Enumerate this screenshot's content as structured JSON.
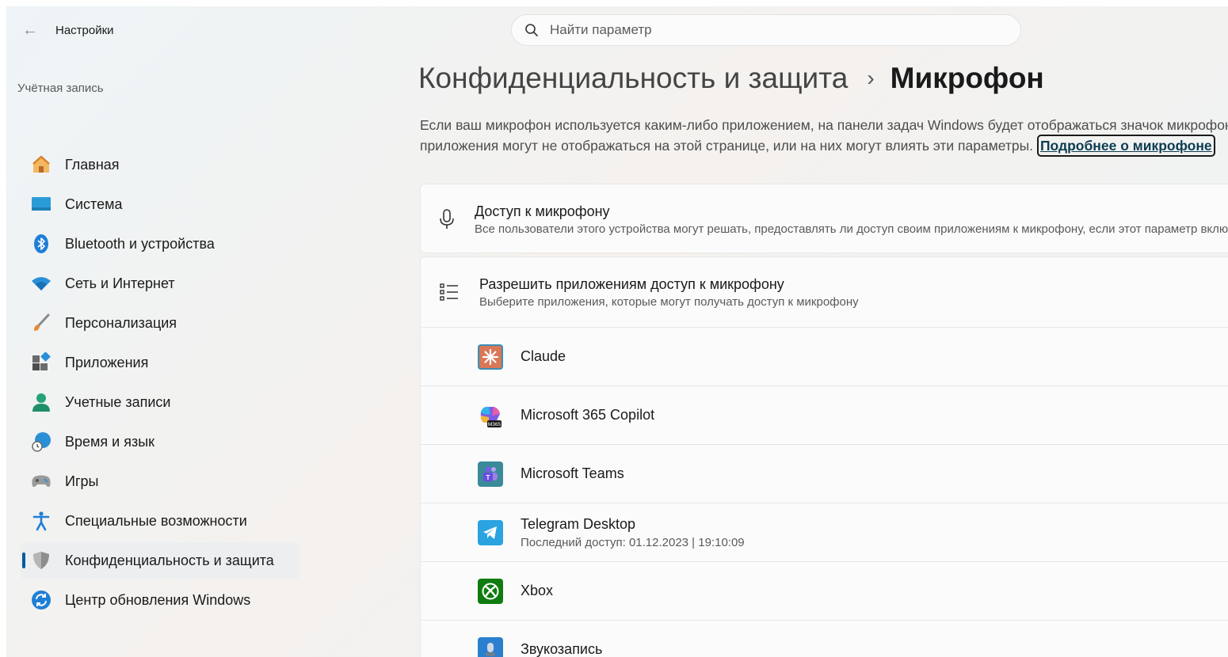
{
  "window": {
    "title": "Настройки",
    "back_arrow": "←"
  },
  "search": {
    "placeholder": "Найти параметр"
  },
  "sidebar": {
    "account_label": "Учётная запись",
    "items": [
      {
        "label": "Главная",
        "icon": "home-icon"
      },
      {
        "label": "Система",
        "icon": "system-icon"
      },
      {
        "label": "Bluetooth и устройства",
        "icon": "bluetooth-icon"
      },
      {
        "label": "Сеть и Интернет",
        "icon": "wifi-icon"
      },
      {
        "label": "Персонализация",
        "icon": "brush-icon"
      },
      {
        "label": "Приложения",
        "icon": "apps-icon"
      },
      {
        "label": "Учетные записи",
        "icon": "user-icon"
      },
      {
        "label": "Время и язык",
        "icon": "globe-clock-icon"
      },
      {
        "label": "Игры",
        "icon": "gamepad-icon"
      },
      {
        "label": "Специальные возможности",
        "icon": "accessibility-icon"
      },
      {
        "label": "Конфиденциальность и защита",
        "icon": "shield-icon",
        "active": true
      },
      {
        "label": "Центр обновления Windows",
        "icon": "update-icon"
      }
    ]
  },
  "breadcrumb": {
    "parent": "Конфиденциальность и защита",
    "separator": "›",
    "current": "Микрофон"
  },
  "description": {
    "line1": "Если ваш микрофон используется каким-либо приложением, на панели задач Windows будет отображаться значок микрофона",
    "line2": "приложения могут не отображаться на этой странице, или на них могут влиять эти параметры. ",
    "link": "Подробнее о микрофоне"
  },
  "mic_access": {
    "title": "Доступ к микрофону",
    "subtitle": "Все пользователи этого устройства могут решать, предоставлять ли доступ своим приложениям к микрофону, если этот параметр включен",
    "icon": "microphone-icon"
  },
  "apps_access": {
    "title": "Разрешить приложениям доступ к микрофону",
    "subtitle": "Выберите приложения, которые могут получать доступ к микрофону",
    "icon": "list-icon",
    "apps": [
      {
        "name": "Claude",
        "meta": "",
        "icon": "claude-icon"
      },
      {
        "name": "Microsoft 365 Copilot",
        "meta": "",
        "icon": "copilot-icon"
      },
      {
        "name": "Microsoft Teams",
        "meta": "",
        "icon": "teams-icon"
      },
      {
        "name": "Telegram Desktop",
        "meta": "Последний доступ: 01.12.2023  |  19:10:09",
        "icon": "telegram-icon"
      },
      {
        "name": "Xbox",
        "meta": "",
        "icon": "xbox-icon"
      },
      {
        "name": "Звукозапись",
        "meta": "",
        "icon": "recorder-icon"
      }
    ]
  },
  "colors": {
    "accent": "#005a9e",
    "link": "#0b3d52",
    "active_bg": "#eceef0"
  }
}
